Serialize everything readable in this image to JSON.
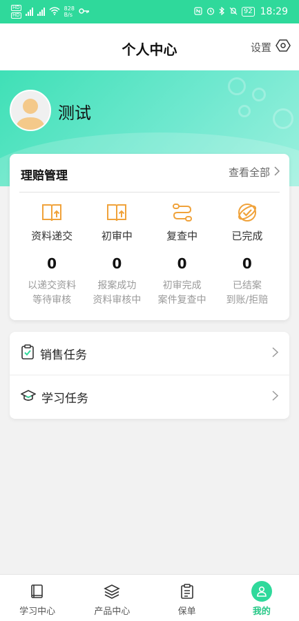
{
  "status_bar": {
    "sim1": "HD",
    "sim2": "HD",
    "net_speed_value": "828",
    "net_speed_unit": "B/s",
    "battery": "92",
    "time": "18:29"
  },
  "header": {
    "title": "个人中心",
    "settings_label": "设置"
  },
  "profile": {
    "username": "测试"
  },
  "claims": {
    "title": "理赔管理",
    "view_all": "查看全部",
    "items": [
      {
        "label": "资料递交",
        "count": "0",
        "desc1": "以递交资料",
        "desc2": "等待审核",
        "icon": "book-upload-icon"
      },
      {
        "label": "初审中",
        "count": "0",
        "desc1": "报案成功",
        "desc2": "资料审核中",
        "icon": "book-review-icon"
      },
      {
        "label": "复查中",
        "count": "0",
        "desc1": "初审完成",
        "desc2": "案件复查中",
        "icon": "route-icon"
      },
      {
        "label": "已完成",
        "count": "0",
        "desc1": "已结案",
        "desc2": "到账/拒赔",
        "icon": "completed-badge-icon"
      }
    ]
  },
  "tasks": [
    {
      "label": "销售任务",
      "icon": "clipboard-check-icon"
    },
    {
      "label": "学习任务",
      "icon": "graduation-cap-icon"
    }
  ],
  "nav": {
    "items": [
      {
        "label": "学习中心",
        "icon": "book-icon",
        "active": false
      },
      {
        "label": "产品中心",
        "icon": "layers-icon",
        "active": false
      },
      {
        "label": "保单",
        "icon": "document-icon",
        "active": false
      },
      {
        "label": "我的",
        "icon": "user-icon",
        "active": true
      }
    ]
  },
  "colors": {
    "primary": "#2fd99b",
    "accent_orange": "#f0a23a",
    "active_nav": "#25c786"
  }
}
